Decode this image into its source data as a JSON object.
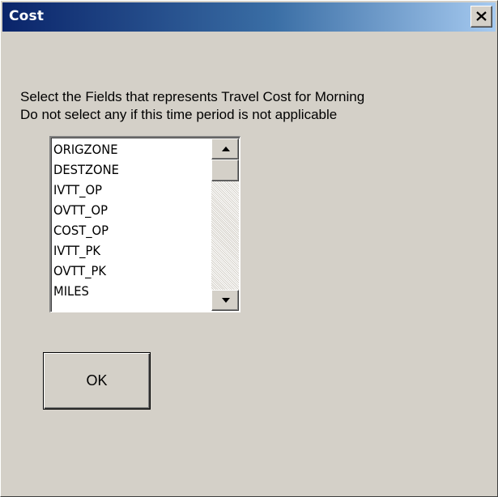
{
  "window": {
    "title": "Cost",
    "close_icon": "close-icon",
    "accent_colors": {
      "titlebar_start": "#0a246a",
      "titlebar_end": "#a6caf0",
      "dialog_face": "#d4d0c8"
    }
  },
  "prompt": {
    "line1": "Select the Fields that represents Travel Cost for Morning",
    "line2": "Do not select any if this time period is not applicable"
  },
  "fields_list": {
    "items": [
      "ORIGZONE",
      "DESTZONE",
      "IVTT_OP",
      "OVTT_OP",
      "COST_OP",
      "IVTT_PK",
      "OVTT_PK",
      "MILES"
    ],
    "selected": [],
    "scroll_icons": [
      "scroll-up-arrow-icon",
      "scroll-down-arrow-icon"
    ]
  },
  "buttons": {
    "ok_label": "OK"
  }
}
